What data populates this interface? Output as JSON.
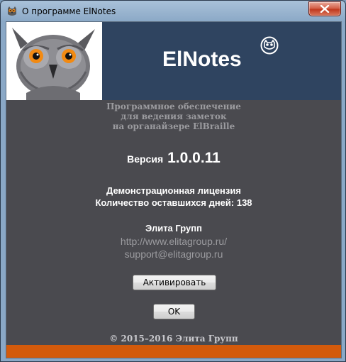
{
  "window": {
    "title": "О программе ElNotes"
  },
  "header": {
    "app_name": "ElNotes"
  },
  "description": {
    "line1": "Программное обеспечение",
    "line2": "для ведения заметок",
    "line3": "на органайзере ElBraille"
  },
  "version": {
    "label": "Версия",
    "number": "1.0.0.11"
  },
  "license": {
    "type": "Демонстрационная лицензия",
    "days_left": "Количество оставшихся дней: 138"
  },
  "company": {
    "name": "Элита Групп",
    "website": "http://www.elitagroup.ru/",
    "email": "support@elitagroup.ru"
  },
  "buttons": {
    "activate": "Активировать",
    "ok": "OK"
  },
  "footer": {
    "copyright": "© 2015–2016 Элита Групп"
  },
  "colors": {
    "header_bg": "#2f4460",
    "body_bg": "#4a4a4f",
    "accent_bar": "#d35a0b"
  },
  "icons": {
    "app": "owl-icon",
    "close": "close-icon",
    "header_logo": "owl-logo-icon"
  }
}
